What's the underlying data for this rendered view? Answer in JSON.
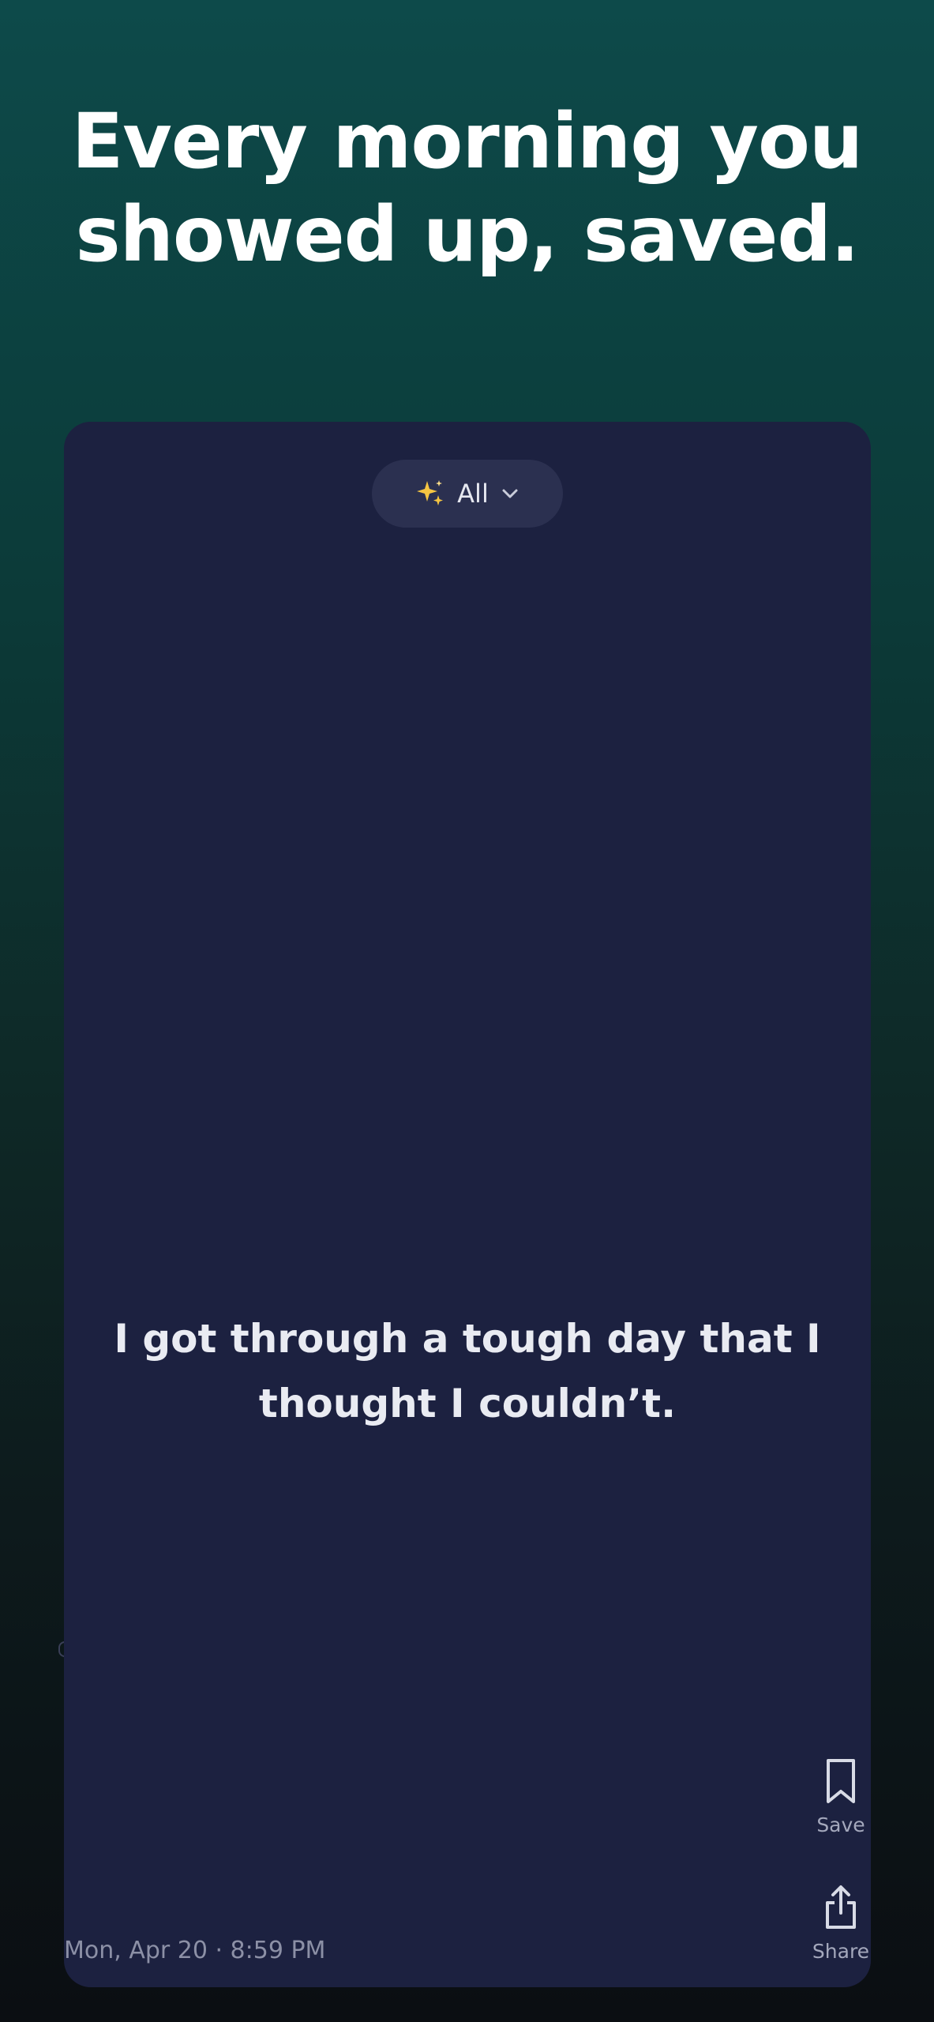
{
  "headline": {
    "line1": "Every morning you",
    "line2": "showed up, saved."
  },
  "filter": {
    "icon": "sparkle-icon",
    "label": "All"
  },
  "entry": {
    "text": "I got through a tough day that I thought I couldn’t.",
    "timestamp": "Mon, Apr 20 · 8:59 PM"
  },
  "actions": {
    "save_label": "Save",
    "share_label": "Share"
  },
  "colors": {
    "card_background": "#1c2140",
    "pill_background": "#2b3050",
    "sparkle": "#f5c542"
  }
}
